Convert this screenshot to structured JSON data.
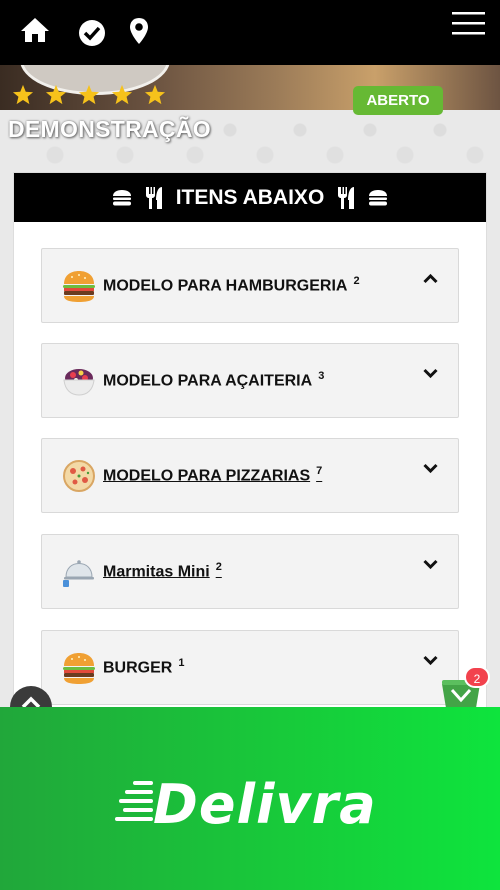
{
  "header": {
    "home_icon": "home-icon",
    "check_icon": "check-circle-icon",
    "location_icon": "location-pin-icon",
    "menu_icon": "hamburger-menu-icon"
  },
  "store": {
    "rating_stars": 5,
    "status": "ABERTO",
    "name": "DEMONSTRAÇÃO"
  },
  "panel": {
    "title": "ITENS ABAIXO"
  },
  "categories": [
    {
      "label": "MODELO PARA HAMBURGERIA",
      "count": "2",
      "icon": "burger-icon",
      "expanded": true
    },
    {
      "label": "MODELO PARA AÇAITERIA",
      "count": "3",
      "icon": "acai-bowl-icon",
      "expanded": false
    },
    {
      "label": "MODELO PARA PIZZARIAS",
      "count": "7",
      "icon": "pizza-icon",
      "expanded": false
    },
    {
      "label": "Marmitas Mini",
      "count": "2",
      "icon": "cloche-icon",
      "expanded": false
    },
    {
      "label": "BURGER",
      "count": "1",
      "icon": "burger-icon",
      "expanded": false
    }
  ],
  "cart": {
    "count": "2"
  },
  "footer": {
    "brand": "Delivra"
  },
  "colors": {
    "header_bg": "#000000",
    "open_badge": "#66b934",
    "footer_start": "#21a73a",
    "footer_end": "#0ee43d",
    "cart_badge": "#f2424d",
    "star": "#f6c21b"
  }
}
